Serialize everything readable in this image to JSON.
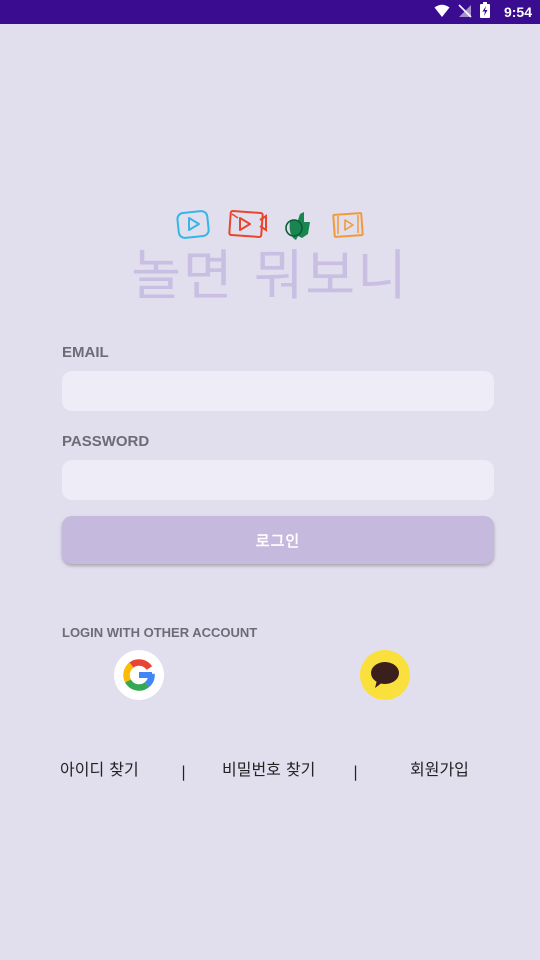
{
  "status_bar": {
    "time": "9:54",
    "background": "#3a0c8f",
    "icons": [
      "wifi-icon",
      "no-signal-icon",
      "battery-charging-icon"
    ]
  },
  "logo": {
    "text": "놀면 뭐보니",
    "color": "#c8bfe3",
    "icons": [
      "play-icon-blue",
      "video-camera-icon-red",
      "thumbs-up-icon-green",
      "film-icon-orange"
    ]
  },
  "form": {
    "email_label": "EMAIL",
    "email_value": "",
    "password_label": "PASSWORD",
    "password_value": "",
    "login_button": "로그인"
  },
  "social": {
    "label": "LOGIN WITH OTHER ACCOUNT",
    "google": "google-icon",
    "kakao": "kakao-talk-icon"
  },
  "links": {
    "find_id": "아이디 찾기",
    "find_password": "비밀번호 찾기",
    "signup": "회원가입",
    "separator": "|"
  },
  "colors": {
    "background": "#e1deee",
    "input_bg": "#eeecf7",
    "button_bg": "#c5b9dd",
    "label": "#6e6b76"
  }
}
